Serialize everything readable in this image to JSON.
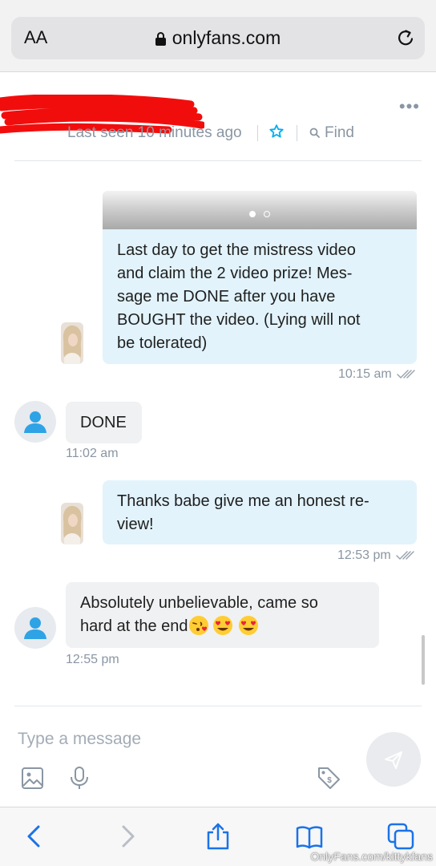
{
  "browser": {
    "text_size_label": "AA",
    "domain": "onlyfans.com",
    "watermark": "OnlyFans.com/kittykfans"
  },
  "chat_header": {
    "last_seen": "Last seen 10 minutes ago",
    "find_label": "Find",
    "menu_label": "•••",
    "star_color": "#00aff0"
  },
  "messages": [
    {
      "direction": "outgoing",
      "text": "Last day to get the mistress video and claim the 2 video prize! Message me DONE after you have BOUGHT the video. (Lying will not be tolerated)",
      "lines": [
        "Last day to get the mistress video",
        "and claim the 2 video prize! Mes-",
        "sage me DONE after you have",
        "BOUGHT the video. (Lying will not",
        "be tolerated)"
      ],
      "time": "10:15 am",
      "read": true,
      "has_media": true,
      "media_pages": 2,
      "media_current_page": 1
    },
    {
      "direction": "incoming",
      "text": "DONE",
      "time": "11:02 am"
    },
    {
      "direction": "outgoing",
      "text": "Thanks babe give me an honest review!",
      "lines": [
        "Thanks babe give me an honest re-",
        "view!"
      ],
      "time": "12:53 pm",
      "read": true
    },
    {
      "direction": "incoming",
      "text": "Absolutely unbelievable, came so hard at the end😘😍😍",
      "lines": [
        "Absolutely unbelievable, came so",
        "hard at the end"
      ],
      "emojis": [
        "kissing-face-emoji",
        "heart-eyes-emoji",
        "heart-eyes-emoji"
      ],
      "time": "12:55 pm"
    }
  ],
  "composer": {
    "placeholder": "Type a message",
    "icons": [
      "image-icon",
      "microphone-icon",
      "price-tag-icon",
      "send-icon"
    ]
  },
  "toolbar": {
    "icons": [
      "back-icon",
      "forward-icon",
      "share-icon",
      "bookmarks-icon",
      "tabs-icon"
    ],
    "accent": "#1a73e8"
  },
  "colors": {
    "outgoing_bubble": "#e2f3fb",
    "incoming_bubble": "#f0f1f2",
    "meta_text": "#8a96a3"
  }
}
